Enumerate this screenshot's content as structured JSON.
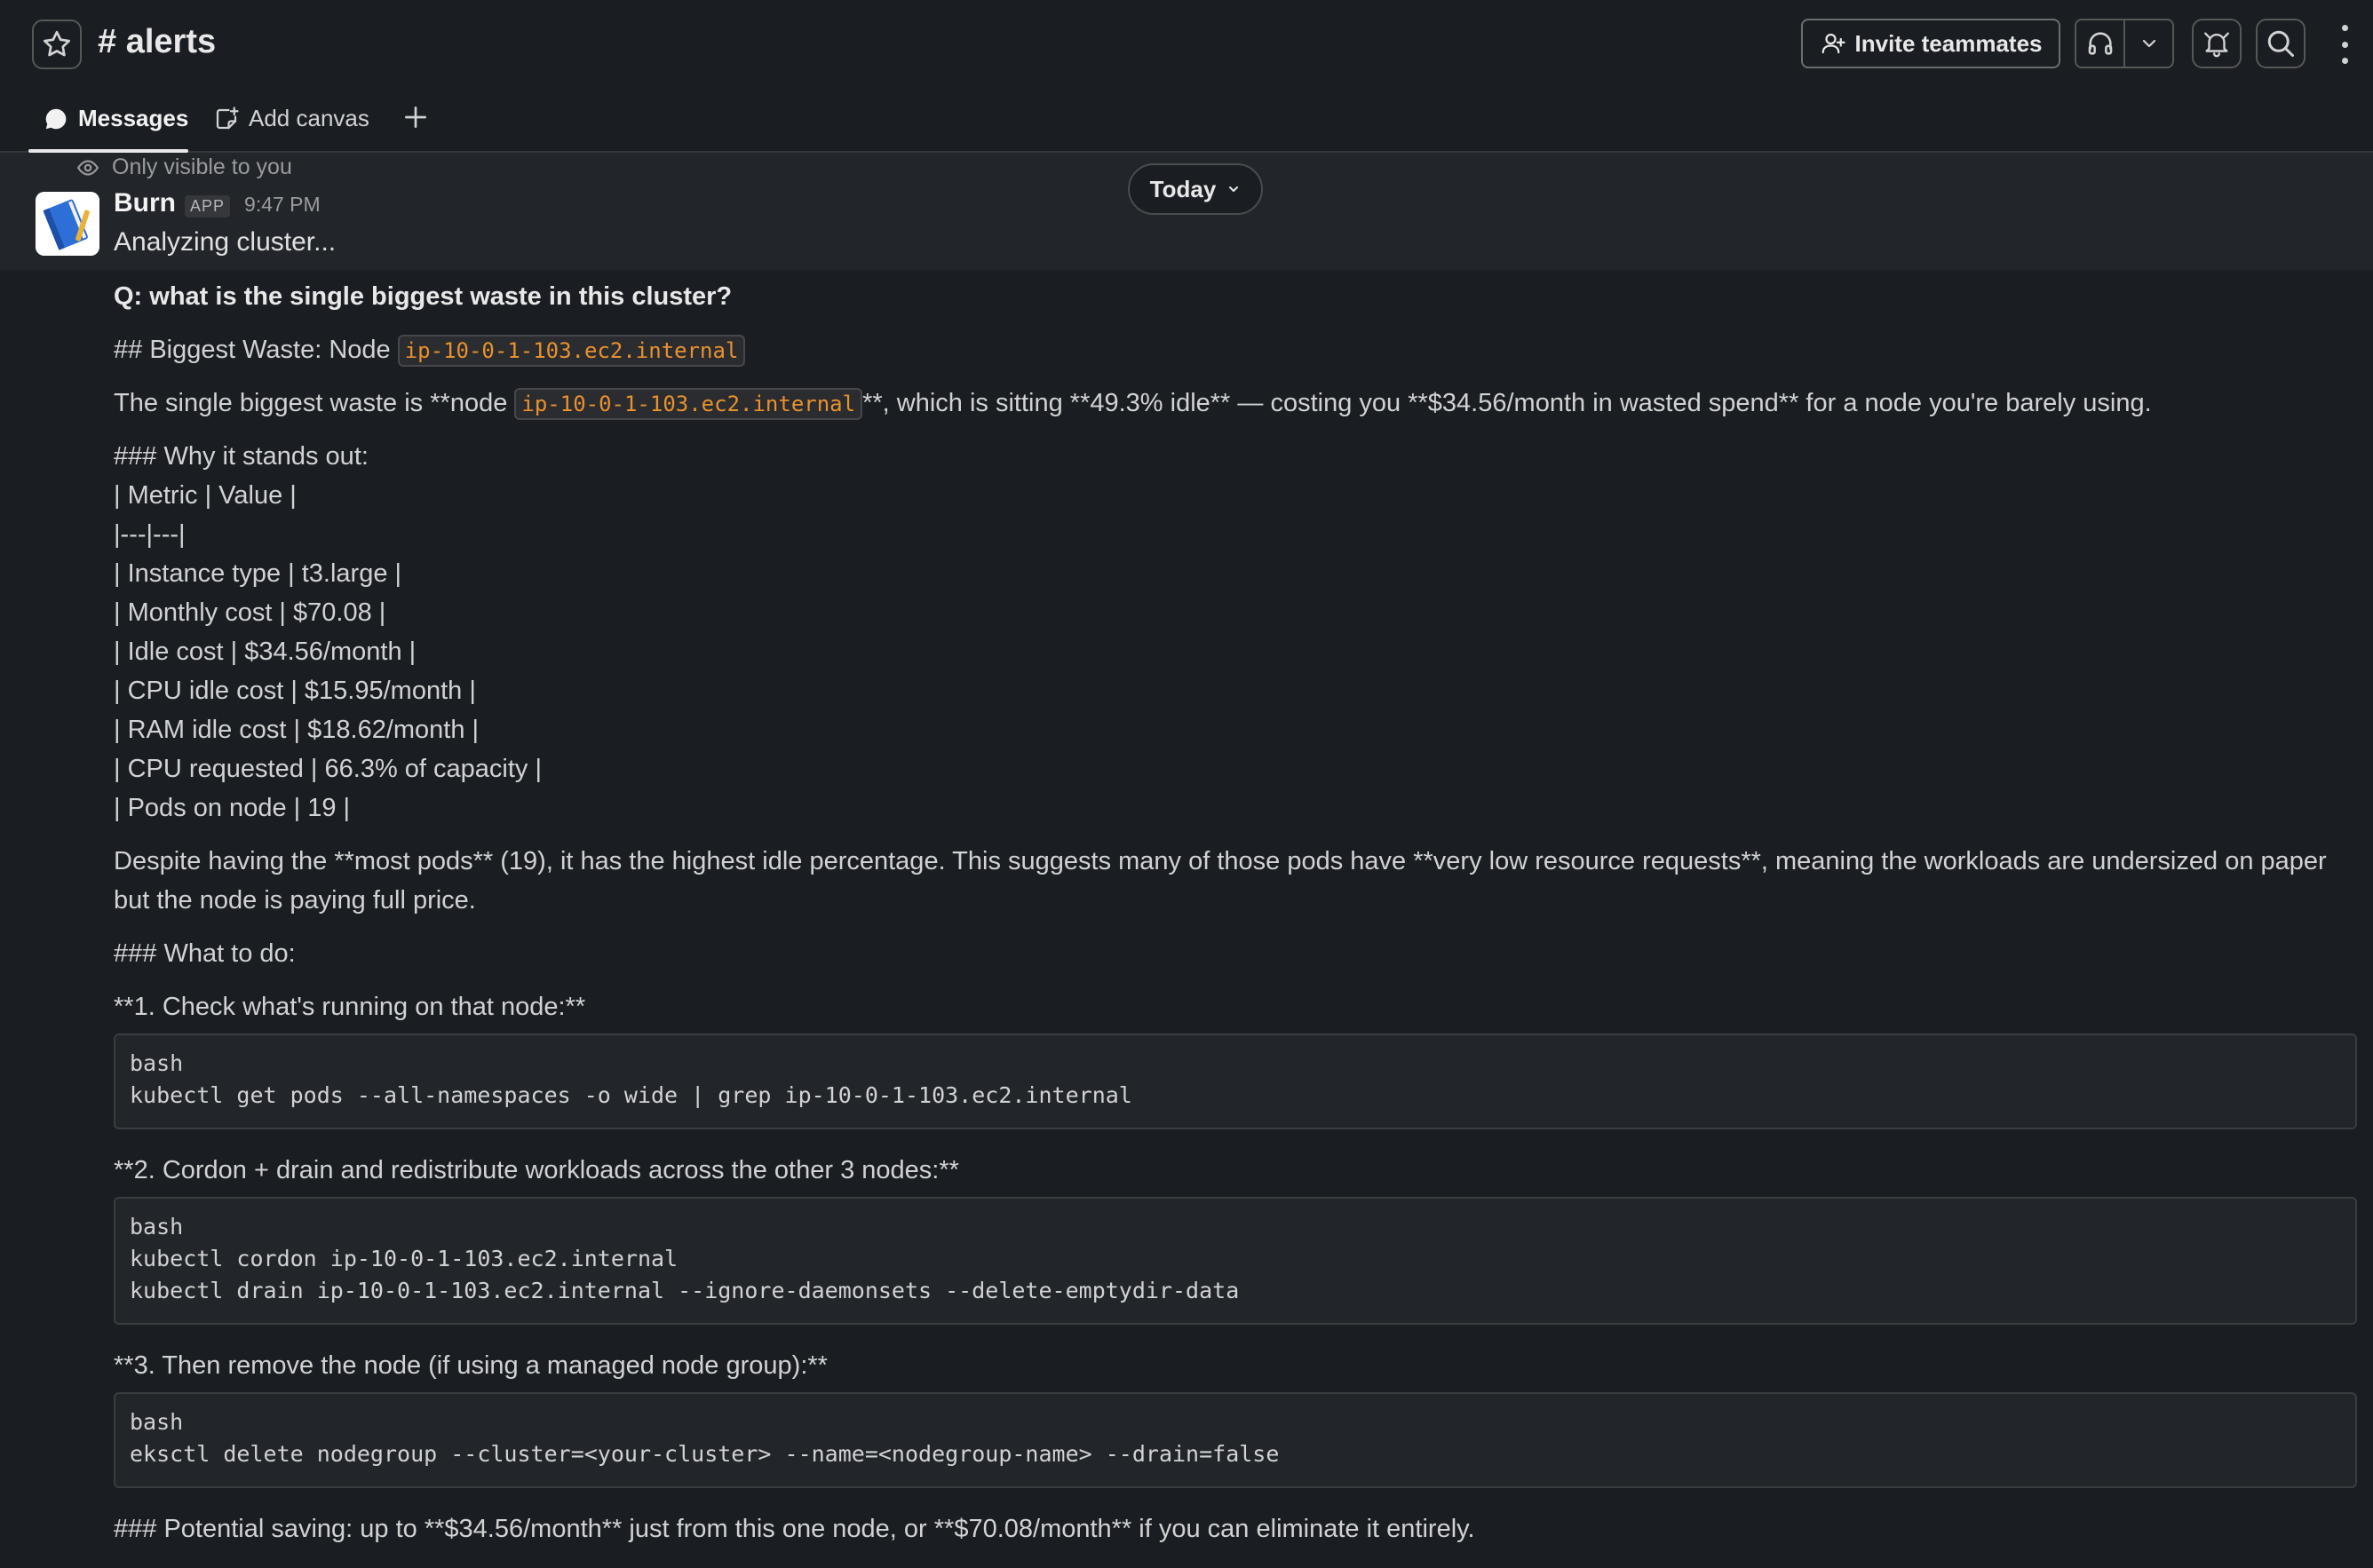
{
  "header": {
    "channel_hash": "#",
    "channel_name": "alerts",
    "invite_label": "Invite teammates"
  },
  "tabs": [
    {
      "label": "Messages"
    },
    {
      "label": "Add canvas"
    }
  ],
  "message": {
    "ephemeral_note": "Only visible to you",
    "sender": "Burn",
    "badge": "APP",
    "time": "9:47 PM",
    "text": "Analyzing cluster..."
  },
  "date_divider": "Today",
  "reply": {
    "question": "Q: what is the single biggest waste in this cluster?",
    "heading_prefix": "## Biggest Waste: Node ",
    "node_name": "ip-10-0-1-103.ec2.internal",
    "summary_before": "The single biggest waste is **node ",
    "summary_after": "**, which is sitting **49.3% idle** — costing you **$34.56/month in wasted spend** for a node you're barely using.",
    "why_heading": "### Why it stands out:",
    "table_lines": [
      "| Metric | Value |",
      "|---|---|",
      "| Instance type | t3.large |",
      "| Monthly cost | $70.08 |",
      "| Idle cost | $34.56/month |",
      "| CPU idle cost | $15.95/month |",
      "| RAM idle cost | $18.62/month |",
      "| CPU requested | 66.3% of capacity |",
      "| Pods on node | 19 |"
    ],
    "despite_line1": "Despite having the **most pods** (19), it has the highest idle percentage. This suggests many of those pods have **very low resource requests**, meaning the workloads are undersized on paper",
    "despite_line2": "but the node is paying full price.",
    "todo_heading": "### What to do:",
    "step1": "**1. Check what's running on that node:**",
    "code1": "bash\nkubectl get pods --all-namespaces -o wide | grep ip-10-0-1-103.ec2.internal",
    "step2": "**2. Cordon + drain and redistribute workloads across the other 3 nodes:**",
    "code2": "bash\nkubectl cordon ip-10-0-1-103.ec2.internal\nkubectl drain ip-10-0-1-103.ec2.internal --ignore-daemonsets --delete-emptydir-data",
    "step3": "**3. Then remove the node (if using a managed node group):**",
    "code3": "bash\neksctl delete nodegroup --cluster=<your-cluster> --name=<nodegroup-name> --drain=false",
    "saving": "### Potential saving: up to **$34.56/month** just from this one node, or **$70.08/month** if you can eliminate it entirely."
  }
}
